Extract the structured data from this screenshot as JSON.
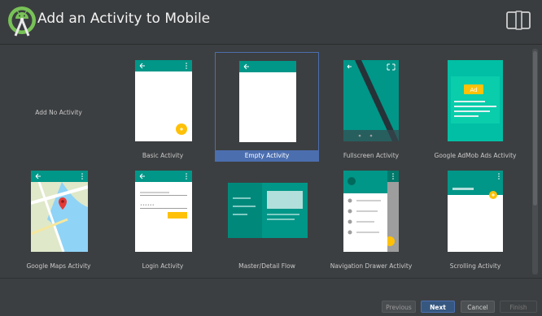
{
  "window": {
    "title": "Add an Activity to Mobile"
  },
  "header_icons": {
    "logo": "android-studio-logo",
    "device": "device-form-factor-icon"
  },
  "templates": [
    {
      "label": "Add No Activity"
    },
    {
      "label": "Basic Activity"
    },
    {
      "label": "Empty Activity",
      "selected": true
    },
    {
      "label": "Fullscreen Activity"
    },
    {
      "label": "Google AdMob Ads Activity",
      "ad_badge": "Ad"
    },
    {
      "label": "Google Maps Activity"
    },
    {
      "label": "Login Activity"
    },
    {
      "label": "Master/Detail Flow"
    },
    {
      "label": "Navigation Drawer Activity"
    },
    {
      "label": "Scrolling Activity"
    }
  ],
  "footer": {
    "previous": "Previous",
    "next": "Next",
    "cancel": "Cancel",
    "finish": "Finish"
  },
  "colors": {
    "accent": "#4b6eaf",
    "teal": "#009688",
    "amber": "#ffc107",
    "background": "#3c3f41"
  }
}
